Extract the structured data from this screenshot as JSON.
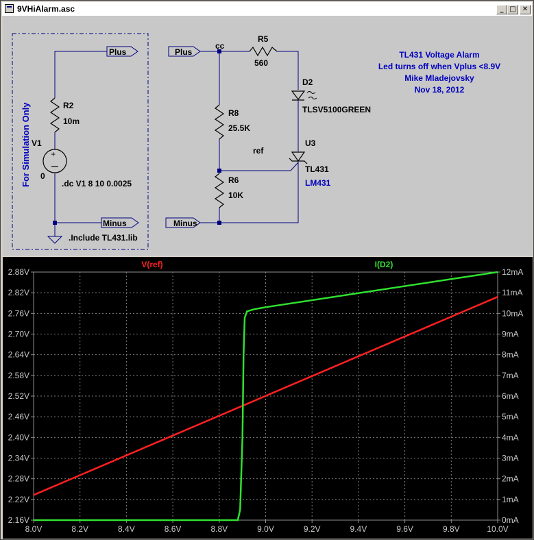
{
  "window": {
    "title": "9VHiAlarm.asc",
    "buttons": {
      "minimize": "_",
      "maximize": "□",
      "close": "✕"
    }
  },
  "schematic": {
    "labels": {
      "plus_left": "Plus",
      "minus_left": "Minus",
      "plus_right": "Plus",
      "minus_right": "Minus",
      "r2": "R2",
      "r2_val": "10m",
      "v1": "V1",
      "v1_val": "0",
      "dc_cmd": ".dc V1  8 10 0.0025",
      "include_cmd": ".Include TL431.lib",
      "sim_only": "For Simulation Only",
      "cc": "cc",
      "r5": "R5",
      "r5_val": "560",
      "d2": "D2",
      "d2_val": "TLSV5100GREEN",
      "r8": "R8",
      "r8_val": "25.5K",
      "ref": "ref",
      "u3": "U3",
      "u3_val": "TL431",
      "u3_alt": "LM431",
      "r6": "R6",
      "r6_val": "10K"
    },
    "notes": [
      "TL431 Voltage Alarm",
      "Led turns off when Vplus <8.9V",
      "Mike Mladejovsky",
      "Nov 18, 2012"
    ]
  },
  "chart_data": {
    "type": "line",
    "series": [
      {
        "name": "V(ref)",
        "color": "#ff2020",
        "axis": "left",
        "x": [
          8.0,
          10.0
        ],
        "y": [
          2.233,
          2.808
        ]
      },
      {
        "name": "I(D2)",
        "color": "#30e030",
        "axis": "right",
        "x": [
          8.0,
          8.88,
          8.89,
          8.9,
          8.905,
          8.91,
          8.92,
          8.95,
          9.0,
          10.0
        ],
        "y": [
          0,
          0,
          0.5,
          4,
          8,
          9.8,
          10.1,
          10.2,
          10.3,
          12.0
        ]
      }
    ],
    "x_ticks": [
      "8.0V",
      "8.2V",
      "8.4V",
      "8.6V",
      "8.8V",
      "9.0V",
      "9.2V",
      "9.4V",
      "9.6V",
      "9.8V",
      "10.0V"
    ],
    "y_left_ticks": [
      "2.88V",
      "2.82V",
      "2.76V",
      "2.70V",
      "2.64V",
      "2.58V",
      "2.52V",
      "2.46V",
      "2.40V",
      "2.34V",
      "2.28V",
      "2.22V",
      "2.16V"
    ],
    "y_right_ticks": [
      "12mA",
      "11mA",
      "10mA",
      "9mA",
      "8mA",
      "7mA",
      "6mA",
      "5mA",
      "4mA",
      "3mA",
      "2mA",
      "1mA",
      "0mA"
    ],
    "xlim": [
      8.0,
      10.0
    ],
    "ylim_left": [
      2.16,
      2.88
    ],
    "ylim_right": [
      0,
      12
    ],
    "grid": true
  }
}
